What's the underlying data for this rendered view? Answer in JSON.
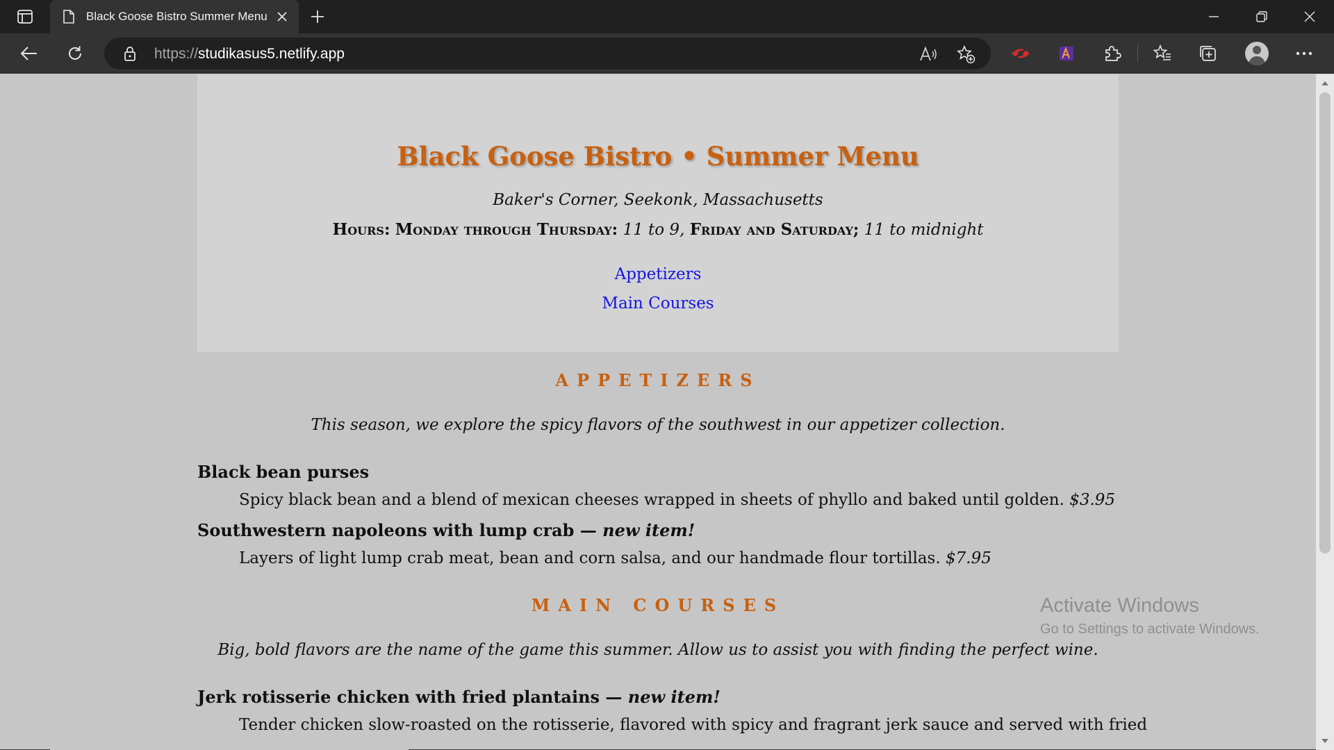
{
  "browser": {
    "tab_title": "Black Goose Bistro Summer Menu",
    "url_protocol": "https://",
    "url_host": "studikasus5.netlify.app",
    "accent_color": "#c8600f"
  },
  "page": {
    "title": "Black Goose Bistro • Summer Menu",
    "subtitle": "Baker's Corner, Seekonk, Massachusetts",
    "hours": {
      "label": "Hours:",
      "weekday_label": "Monday through Thursday:",
      "weekday_time": "11 to 9,",
      "weekend_label": "Friday and Saturday;",
      "weekend_time": "11 to midnight"
    },
    "nav": {
      "appetizers": "Appetizers",
      "main_courses": "Main Courses"
    },
    "appetizers": {
      "heading": "APPETIZERS",
      "intro": "This season, we explore the spicy flavors of the southwest in our appetizer collection.",
      "items": [
        {
          "name": "Black bean purses",
          "new_label": "",
          "description": "Spicy black bean and a blend of mexican cheeses wrapped in sheets of phyllo and baked until golden.",
          "price": "$3.95"
        },
        {
          "name": "Southwestern napoleons with lump crab —",
          "new_label": "new item!",
          "description": "Layers of light lump crab meat, bean and corn salsa, and our handmade flour tortillas.",
          "price": "$7.95"
        }
      ]
    },
    "main_courses": {
      "heading": "MAIN COURSES",
      "intro": "Big, bold flavors are the name of the game this summer. Allow us to assist you with finding the perfect wine.",
      "items": [
        {
          "name": "Jerk rotisserie chicken with fried plantains —",
          "new_label": "new item!",
          "description": "Tender chicken slow-roasted on the rotisserie, flavored with spicy and fragrant jerk sauce and served with fried",
          "price": ""
        }
      ]
    }
  },
  "watermark": {
    "line1": "Activate Windows",
    "line2": "Go to Settings to activate Windows."
  }
}
